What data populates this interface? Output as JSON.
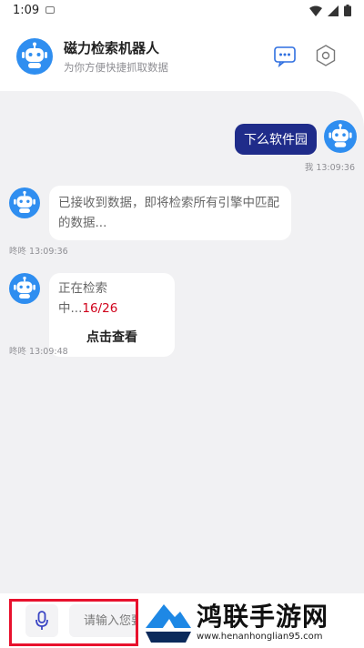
{
  "status_bar": {
    "time": "1:09",
    "icons": [
      "wifi-icon",
      "signal-icon",
      "battery-icon"
    ]
  },
  "header": {
    "title": "磁力检索机器人",
    "subtitle": "为你方便快捷抓取数据",
    "buttons": [
      "more-icon",
      "settings-icon"
    ]
  },
  "messages": [
    {
      "side": "right",
      "text": "下么软件园",
      "meta": "我 13:09:36"
    },
    {
      "side": "left",
      "text": "已接收到数据，即将检索所有引擎中匹配的数据...",
      "meta": "咚咚 13:09:36"
    },
    {
      "side": "left",
      "text": "正在检索中...",
      "progress": "16/26",
      "action": "点击查看",
      "meta": "咚咚 13:09:48"
    }
  ],
  "input_bar": {
    "placeholder": "请输入您要",
    "mic_icon": "microphone-icon"
  },
  "watermark": {
    "title": "鸿联手游网",
    "url": "www.henanhonglian95.com"
  },
  "colors": {
    "accent": "#1f2c8a",
    "avatar": "#2f8ef0",
    "chat_bg": "#f1f1f3",
    "progress": "#d0021b",
    "highlight": "#e8112d"
  }
}
